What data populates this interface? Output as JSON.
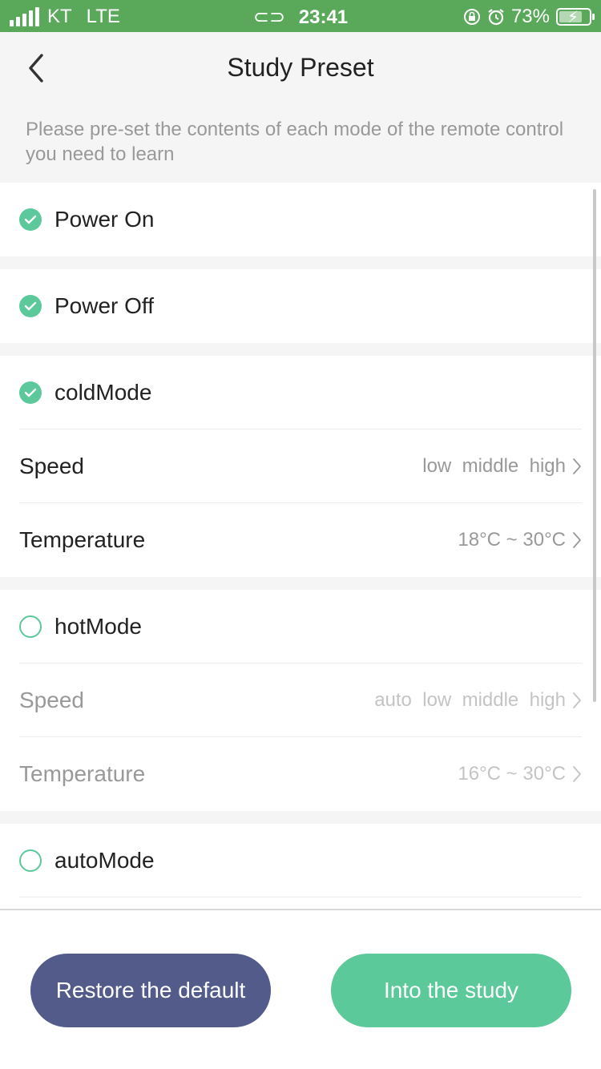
{
  "status_bar": {
    "carrier": "KT",
    "network": "LTE",
    "time": "23:41",
    "battery_percent": "73%",
    "battery_level": 0.73,
    "icons": [
      "signal-icon",
      "link-icon",
      "rotation-lock-icon",
      "alarm-icon",
      "battery-charging-icon"
    ]
  },
  "header": {
    "title": "Study Preset",
    "back_icon": "chevron-left-icon"
  },
  "hint": "Please pre-set the contents of each mode of the remote control you need to learn",
  "sections": {
    "power_on": {
      "label": "Power On",
      "checked": true
    },
    "power_off": {
      "label": "Power Off",
      "checked": true
    },
    "cold_mode": {
      "label": "coldMode",
      "checked": true,
      "speed_label": "Speed",
      "speed_value": "low  middle  high",
      "temp_label": "Temperature",
      "temp_value": "18°C ~ 30°C"
    },
    "hot_mode": {
      "label": "hotMode",
      "checked": false,
      "speed_label": "Speed",
      "speed_value": "auto  low  middle  high",
      "temp_label": "Temperature",
      "temp_value": "16°C ~ 30°C"
    },
    "auto_mode": {
      "label": "autoMode",
      "checked": false
    }
  },
  "footer": {
    "restore_label": "Restore the default",
    "study_label": "Into the study"
  },
  "colors": {
    "status_bar": "#5aa85a",
    "accent_green": "#5cc99a",
    "restore_button": "#535b8b",
    "background": "#f5f5f5"
  }
}
